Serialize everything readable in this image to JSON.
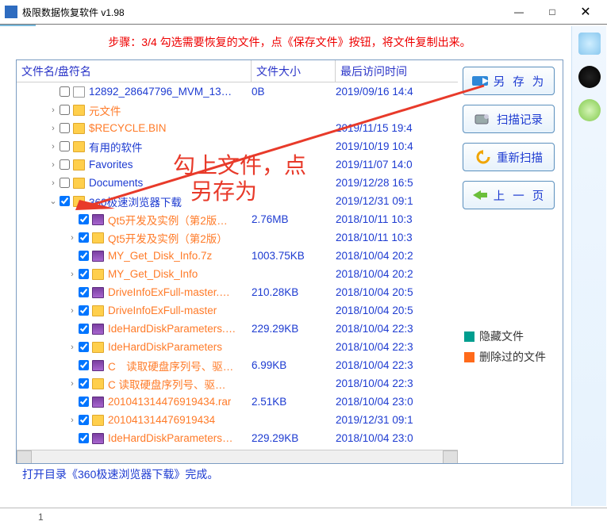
{
  "window": {
    "title": "极限数据恢复软件 v1.98",
    "min": "—",
    "max": "□",
    "close": "✕"
  },
  "step_message": "步骤：3/4 勾选需要恢复的文件，点《保存文件》按钮，将文件复制出来。",
  "columns": {
    "name": "文件名/盘符名",
    "size": "文件大小",
    "date": "最后访问时间"
  },
  "buttons": {
    "save_as": "另 存 为",
    "scan_log": "扫描记录",
    "rescan": "重新扫描",
    "prev_page": "上 一 页"
  },
  "legend": {
    "hidden": "隐藏文件",
    "deleted": "删除过的文件"
  },
  "status": "打开目录《360极速浏览器下载》完成。",
  "tab_num": "1",
  "annotation": {
    "line1": "勾上文件，点",
    "line2": "另存为"
  },
  "rows": [
    {
      "indent": 0,
      "exp": "",
      "chk": false,
      "icon": "page",
      "cls": "",
      "name": "12892_28647796_MVM_13…",
      "size": "0B",
      "date": "2019/09/16 14:4"
    },
    {
      "indent": 0,
      "exp": "›",
      "chk": false,
      "icon": "folder",
      "cls": "orange",
      "name": "元文件",
      "size": "",
      "date": ""
    },
    {
      "indent": 0,
      "exp": "›",
      "chk": false,
      "icon": "folder",
      "cls": "orange",
      "name": "$RECYCLE.BIN",
      "size": "",
      "date": "2019/11/15 19:4"
    },
    {
      "indent": 0,
      "exp": "›",
      "chk": false,
      "icon": "folder",
      "cls": "",
      "name": "有用的软件",
      "size": "",
      "date": "2019/10/19 10:4"
    },
    {
      "indent": 0,
      "exp": "›",
      "chk": false,
      "icon": "folder",
      "cls": "",
      "name": "Favorites",
      "size": "",
      "date": "2019/11/07 14:0"
    },
    {
      "indent": 0,
      "exp": "›",
      "chk": false,
      "icon": "folder",
      "cls": "",
      "name": "Documents",
      "size": "",
      "date": "2019/12/28 16:5"
    },
    {
      "indent": 0,
      "exp": "⌄",
      "chk": true,
      "icon": "folder",
      "cls": "",
      "name": "360极速浏览器下载",
      "size": "",
      "date": "2019/12/31 09:1"
    },
    {
      "indent": 1,
      "exp": "",
      "chk": true,
      "icon": "rar",
      "cls": "orange",
      "name": "Qt5开发及实例（第2版…",
      "size": "2.76MB",
      "date": "2018/10/11 10:3"
    },
    {
      "indent": 1,
      "exp": "›",
      "chk": true,
      "icon": "folder",
      "cls": "orange",
      "name": "Qt5开发及实例（第2版）",
      "size": "",
      "date": "2018/10/11 10:3"
    },
    {
      "indent": 1,
      "exp": "",
      "chk": true,
      "icon": "rar",
      "cls": "orange",
      "name": "MY_Get_Disk_Info.7z",
      "size": "1003.75KB",
      "date": "2018/10/04 20:2"
    },
    {
      "indent": 1,
      "exp": "›",
      "chk": true,
      "icon": "folder",
      "cls": "orange",
      "name": "MY_Get_Disk_Info",
      "size": "",
      "date": "2018/10/04 20:2"
    },
    {
      "indent": 1,
      "exp": "",
      "chk": true,
      "icon": "rar",
      "cls": "orange",
      "name": "DriveInfoExFull-master.…",
      "size": "210.28KB",
      "date": "2018/10/04 20:5"
    },
    {
      "indent": 1,
      "exp": "›",
      "chk": true,
      "icon": "folder",
      "cls": "orange",
      "name": "DriveInfoExFull-master",
      "size": "",
      "date": "2018/10/04 20:5"
    },
    {
      "indent": 1,
      "exp": "",
      "chk": true,
      "icon": "rar",
      "cls": "orange",
      "name": "IdeHardDiskParameters.…",
      "size": "229.29KB",
      "date": "2018/10/04 22:3"
    },
    {
      "indent": 1,
      "exp": "›",
      "chk": true,
      "icon": "folder",
      "cls": "orange",
      "name": "IdeHardDiskParameters",
      "size": "",
      "date": "2018/10/04 22:3"
    },
    {
      "indent": 1,
      "exp": "",
      "chk": true,
      "icon": "rar",
      "cls": "orange",
      "name": "C　读取硬盘序列号、驱…",
      "size": "6.99KB",
      "date": "2018/10/04 22:3"
    },
    {
      "indent": 1,
      "exp": "›",
      "chk": true,
      "icon": "folder",
      "cls": "orange",
      "name": "C  读取硬盘序列号、驱…",
      "size": "",
      "date": "2018/10/04 22:3"
    },
    {
      "indent": 1,
      "exp": "",
      "chk": true,
      "icon": "rar",
      "cls": "orange",
      "name": "201041314476919434.rar",
      "size": "2.51KB",
      "date": "2018/10/04 23:0"
    },
    {
      "indent": 1,
      "exp": "›",
      "chk": true,
      "icon": "folder",
      "cls": "orange",
      "name": "201041314476919434",
      "size": "",
      "date": "2019/12/31 09:1"
    },
    {
      "indent": 1,
      "exp": "",
      "chk": true,
      "icon": "rar",
      "cls": "orange",
      "name": "IdeHardDiskParameters…",
      "size": "229.29KB",
      "date": "2018/10/04 23:0"
    }
  ]
}
